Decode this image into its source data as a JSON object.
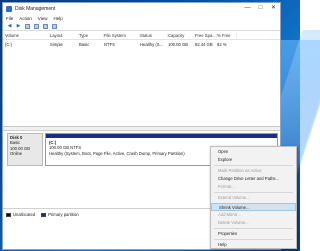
{
  "window": {
    "title": "Disk Management"
  },
  "title_buttons": {
    "minimize": "—",
    "maximize": "□",
    "close": "✕"
  },
  "menu": [
    "File",
    "Action",
    "View",
    "Help"
  ],
  "toolbar": {
    "icons": [
      "back-arrow-icon",
      "forward-arrow-icon",
      "panel-icon",
      "help-icon",
      "properties-icon",
      "refresh-icon"
    ]
  },
  "volume_table": {
    "headers": [
      "Volume",
      "Layout",
      "Type",
      "File System",
      "Status",
      "Capacity",
      "Free Spa...",
      "% Free"
    ],
    "rows": [
      [
        "(C:)",
        "Simple",
        "Basic",
        "NTFS",
        "Healthy (S...",
        "100.00 GB",
        "82.44 GB",
        "82 %"
      ]
    ]
  },
  "disk": {
    "name": "Disk 0",
    "type": "Basic",
    "size": "100.00 GB",
    "state": "Online"
  },
  "partition": {
    "name": "(C:)",
    "size_fs": "100.00 GB NTFS",
    "status": "Healthy (System, Boot, Page File, Active, Crash Dump, Primary Partition)"
  },
  "legend": [
    {
      "label": "Unallocated",
      "color": "#111111"
    },
    {
      "label": "Primary partition",
      "color": "#1a2e86"
    }
  ],
  "context_menu": {
    "groups": [
      [
        {
          "label": "Open",
          "enabled": true
        },
        {
          "label": "Explore",
          "enabled": true
        }
      ],
      [
        {
          "label": "Mark Partition as Active",
          "enabled": false
        },
        {
          "label": "Change Drive Letter and Paths...",
          "enabled": true
        },
        {
          "label": "Format...",
          "enabled": false
        }
      ],
      [
        {
          "label": "Extend Volume...",
          "enabled": false
        },
        {
          "label": "Shrink Volume...",
          "enabled": true,
          "highlighted": true
        },
        {
          "label": "Add Mirror...",
          "enabled": false
        },
        {
          "label": "Delete Volume...",
          "enabled": false
        }
      ],
      [
        {
          "label": "Properties",
          "enabled": true
        }
      ],
      [
        {
          "label": "Help",
          "enabled": true
        }
      ]
    ]
  }
}
